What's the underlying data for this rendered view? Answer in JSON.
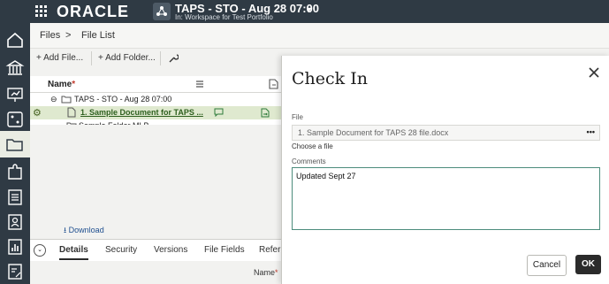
{
  "topbar": {
    "logo": "ORACLE",
    "workspace_title": "TAPS - STO - Aug 28 07:00",
    "workspace_sub": "In: Workspace for Test Portfolio"
  },
  "breadcrumb": {
    "files": "Files",
    "sep": ">",
    "list": "File List"
  },
  "toolbar": {
    "add_file": "Add File...",
    "add_folder": "Add Folder..."
  },
  "table": {
    "name_header": "Name",
    "required_mark": "*",
    "rows": [
      {
        "label": "TAPS - STO - Aug 28 07:00"
      },
      {
        "label": "1. Sample Document for TAPS ..."
      },
      {
        "label": "Sample Folder MLB"
      }
    ]
  },
  "download": "Download",
  "tabs": [
    "Details",
    "Security",
    "Versions",
    "File Fields",
    "Refere"
  ],
  "detail": {
    "name_label": "Name"
  },
  "modal": {
    "title": "Check In",
    "file_label": "File",
    "file_value": "1. Sample Document for TAPS 28 file.docx",
    "more_dots": "•••",
    "choose_file": "Choose a file",
    "comments_label": "Comments",
    "comments_value": "Updated Sept 27",
    "cancel": "Cancel",
    "ok": "OK"
  },
  "colors": {
    "topbar": "#2f3a44",
    "accent": "#4c8c7c",
    "link": "#1f4f8f"
  }
}
